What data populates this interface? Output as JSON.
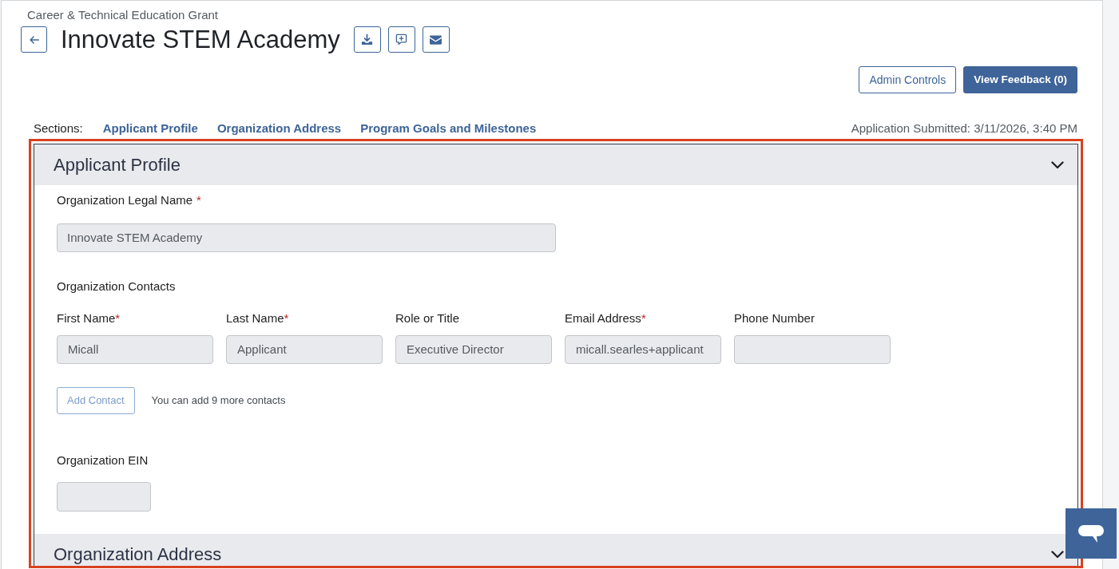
{
  "header": {
    "breadcrumb": "Career & Technical Education Grant",
    "title": "Innovate STEM Academy",
    "toolbar": [
      {
        "kind": "download"
      },
      {
        "kind": "comment"
      },
      {
        "kind": "email"
      }
    ]
  },
  "actions": [
    {
      "label": "Admin Controls",
      "kind": "outline"
    },
    {
      "label": "View Feedback (0)",
      "kind": "primary"
    }
  ],
  "section_nav": {
    "label": "Sections:",
    "links": [
      "Applicant Profile",
      "Organization Address",
      "Program Goals and Milestones"
    ],
    "submitted": "Application Submitted: 3/11/2026, 3:40 PM"
  },
  "sections": [
    {
      "title": "Applicant Profile",
      "content": [
        {
          "kind": "text_field",
          "label": "Organization Legal Name",
          "required_mark": "*",
          "value": "Innovate STEM Academy"
        },
        {
          "kind": "contacts",
          "label": "Organization Contacts",
          "columns": [
            {
              "label": "First Name",
              "required_mark": "*",
              "value": "Micall"
            },
            {
              "label": "Last Name",
              "required_mark": "*",
              "value": "Applicant"
            },
            {
              "label": "Role or Title",
              "value": "Executive Director"
            },
            {
              "label": "Email Address",
              "required_mark": "*",
              "value": "micall.searles+applicant"
            },
            {
              "label": "Phone Number"
            }
          ],
          "add_button": {
            "label": "Add Contact",
            "disabled": true
          },
          "note": "You can add 9 more contacts"
        },
        {
          "kind": "short_field",
          "label": "Organization EIN"
        }
      ]
    },
    {
      "title": "Organization Address"
    }
  ]
}
